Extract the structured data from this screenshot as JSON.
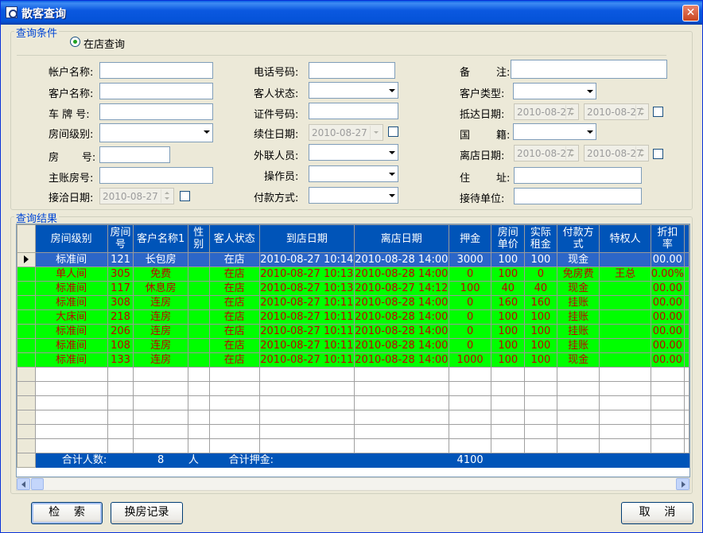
{
  "window": {
    "title": "散客查询",
    "close_glyph": "✕"
  },
  "query": {
    "group_title": "查询条件",
    "radio_label": "在店查询",
    "fields": {
      "account_name": {
        "label": "帐户名称:"
      },
      "customer_name": {
        "label": "客户名称:"
      },
      "plate_no": {
        "label": "车 牌 号:"
      },
      "room_level": {
        "label": "房间级别:"
      },
      "room_no": {
        "label": "房       号:"
      },
      "main_room_no": {
        "label": "主账房号:"
      },
      "contact_date": {
        "label": "接洽日期:",
        "value": "2010-08-27"
      },
      "phone": {
        "label": "电话号码:"
      },
      "guest_status": {
        "label": "客人状态:"
      },
      "id_no": {
        "label": "证件号码:"
      },
      "extend_date": {
        "label": "续住日期:",
        "value": "2010-08-27"
      },
      "liaison": {
        "label": "外联人员:"
      },
      "operator": {
        "label": "操作员:"
      },
      "payment": {
        "label": "付款方式:"
      },
      "remark": {
        "label": "备        注:"
      },
      "customer_type": {
        "label": "客户类型:"
      },
      "arrive_date": {
        "label": "抵达日期:",
        "from": "2010-08-27",
        "to": "2010-08-27"
      },
      "nationality": {
        "label": "国        籍:"
      },
      "leave_date": {
        "label": "离店日期:",
        "from": "2010-08-27",
        "to": "2010-08-27"
      },
      "address": {
        "label": "住        址:"
      },
      "host_unit": {
        "label": "接待单位:"
      }
    }
  },
  "results": {
    "group_title": "查询结果",
    "columns": [
      {
        "key": "level",
        "label": "房间级别"
      },
      {
        "key": "room",
        "label": "房间\n号"
      },
      {
        "key": "name",
        "label": "客户名称1"
      },
      {
        "key": "sex",
        "label": "性\n别"
      },
      {
        "key": "status",
        "label": "客人状态"
      },
      {
        "key": "arrive",
        "label": "到店日期"
      },
      {
        "key": "leave",
        "label": "离店日期"
      },
      {
        "key": "deposit",
        "label": "押金"
      },
      {
        "key": "price",
        "label": "房间\n单价"
      },
      {
        "key": "rent",
        "label": "实际\n租金"
      },
      {
        "key": "pay",
        "label": "付款方\n式"
      },
      {
        "key": "vip",
        "label": "特权人"
      },
      {
        "key": "discount",
        "label": "折扣\n率"
      }
    ],
    "rows": [
      {
        "level": "标准间",
        "room": "121",
        "name": "长包房",
        "sex": "",
        "status": "在店",
        "arrive": "2010-08-27 10:14",
        "leave": "2010-08-28 14:00",
        "deposit": "3000",
        "price": "100",
        "rent": "100",
        "pay": "现金",
        "vip": "",
        "discount": "00.00"
      },
      {
        "level": "单人间",
        "room": "305",
        "name": "免费",
        "sex": "",
        "status": "在店",
        "arrive": "2010-08-27 10:13",
        "leave": "2010-08-28 14:00",
        "deposit": "0",
        "price": "100",
        "rent": "0",
        "pay": "免房费",
        "vip": "王总",
        "discount": "0.00%"
      },
      {
        "level": "标准间",
        "room": "117",
        "name": "休息房",
        "sex": "",
        "status": "在店",
        "arrive": "2010-08-27 10:13",
        "leave": "2010-08-27 14:12",
        "deposit": "100",
        "price": "40",
        "rent": "40",
        "pay": "现金",
        "vip": "",
        "discount": "00.00"
      },
      {
        "level": "标准间",
        "room": "308",
        "name": "连房",
        "sex": "",
        "status": "在店",
        "arrive": "2010-08-27 10:11",
        "leave": "2010-08-28 14:00",
        "deposit": "0",
        "price": "160",
        "rent": "160",
        "pay": "挂账",
        "vip": "",
        "discount": "00.00"
      },
      {
        "level": "大床间",
        "room": "218",
        "name": "连房",
        "sex": "",
        "status": "在店",
        "arrive": "2010-08-27 10:11",
        "leave": "2010-08-28 14:00",
        "deposit": "0",
        "price": "100",
        "rent": "100",
        "pay": "挂账",
        "vip": "",
        "discount": "00.00"
      },
      {
        "level": "标准间",
        "room": "206",
        "name": "连房",
        "sex": "",
        "status": "在店",
        "arrive": "2010-08-27 10:11",
        "leave": "2010-08-28 14:00",
        "deposit": "0",
        "price": "100",
        "rent": "100",
        "pay": "挂账",
        "vip": "",
        "discount": "00.00"
      },
      {
        "level": "标准间",
        "room": "108",
        "name": "连房",
        "sex": "",
        "status": "在店",
        "arrive": "2010-08-27 10:11",
        "leave": "2010-08-28 14:00",
        "deposit": "0",
        "price": "100",
        "rent": "100",
        "pay": "挂账",
        "vip": "",
        "discount": "00.00"
      },
      {
        "level": "标准间",
        "room": "133",
        "name": "连房",
        "sex": "",
        "status": "在店",
        "arrive": "2010-08-27 10:11",
        "leave": "2010-08-28 14:00",
        "deposit": "1000",
        "price": "100",
        "rent": "100",
        "pay": "现金",
        "vip": "",
        "discount": "00.00"
      }
    ],
    "total": {
      "people_label": "合计人数:",
      "people_count": "8",
      "people_unit": "人",
      "deposit_label": "合计押金:",
      "deposit_sum": "4100"
    }
  },
  "buttons": {
    "search": "检    索",
    "history": "换房记录",
    "cancel": "取    消"
  }
}
